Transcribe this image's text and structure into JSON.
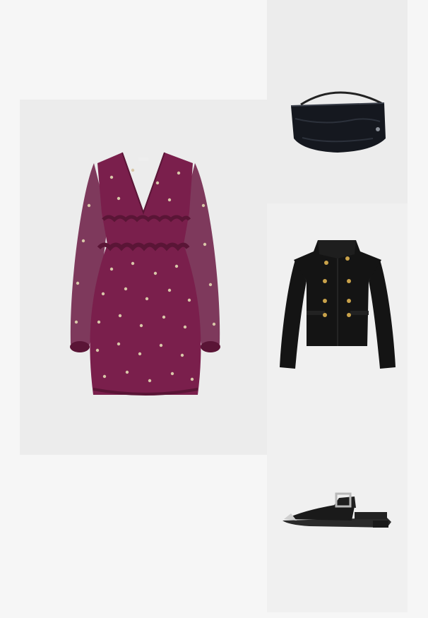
{
  "outfit": {
    "items": [
      {
        "product": "dress",
        "icon": "dress-icon",
        "color": "#7a1f4c",
        "dot_color": "#d8c7a8"
      },
      {
        "product": "bag",
        "icon": "bag-icon",
        "color": "#15181f"
      },
      {
        "product": "jacket",
        "icon": "jacket-icon",
        "color": "#141414",
        "button_color": "#c9a24a"
      },
      {
        "product": "shoe",
        "icon": "shoe-icon",
        "color": "#1a1a1a",
        "buckle_color": "#b9b9b9"
      }
    ]
  }
}
